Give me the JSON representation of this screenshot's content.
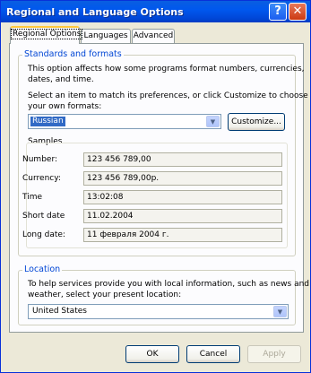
{
  "window": {
    "title": "Regional and Language Options",
    "help_glyph": "?",
    "close_glyph": "✕"
  },
  "tabs": [
    {
      "label": "Regional Options",
      "active": true
    },
    {
      "label": "Languages",
      "active": false
    },
    {
      "label": "Advanced",
      "active": false
    }
  ],
  "standards": {
    "group_label": "Standards and formats",
    "description": [
      "This option affects how some programs format numbers, currencies,",
      "dates, and time."
    ],
    "instruction": [
      "Select an item to match its preferences, or click Customize to choose",
      "your own formats:"
    ],
    "selected_format": "Russian",
    "customize_label": "Customize..."
  },
  "samples": {
    "title": "Samples",
    "rows": [
      {
        "label": "Number:",
        "value": "123 456 789,00"
      },
      {
        "label": "Currency:",
        "value": "123 456 789,00р."
      },
      {
        "label": "Time",
        "value": "13:02:08"
      },
      {
        "label": "Short date",
        "value": "11.02.2004"
      },
      {
        "label": "Long date:",
        "value": "11 февраля 2004 г."
      }
    ]
  },
  "location": {
    "group_label": "Location",
    "description": [
      "To help services provide you with local information, such as news and",
      "weather, select your present location:"
    ],
    "selected": "United States"
  },
  "footer": {
    "ok_label": "OK",
    "cancel_label": "Cancel",
    "apply_label": "Apply"
  }
}
